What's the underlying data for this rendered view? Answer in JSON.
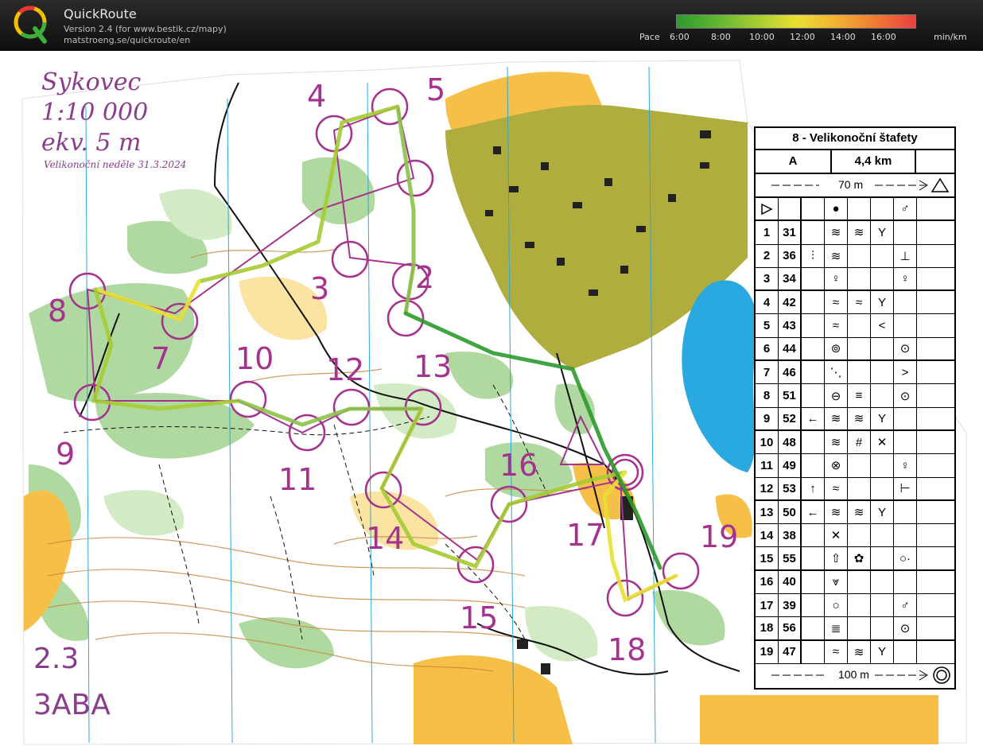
{
  "app": {
    "title": "QuickRoute",
    "version": "Version 2.4  (for www.bestik.cz/mapy)",
    "url": "matstroeng.se/quickroute/en",
    "logo_letter": "Q"
  },
  "pace_legend": {
    "label": "Pace",
    "ticks": [
      "6:00",
      "8:00",
      "10:00",
      "12:00",
      "14:00",
      "16:00"
    ],
    "unit": "min/km",
    "colors": [
      "#2e9a2e",
      "#5fb533",
      "#a6cc33",
      "#e8e033",
      "#f2b233",
      "#f07a33",
      "#e84040"
    ]
  },
  "map": {
    "name": "Sykovec",
    "scale": "1:10 000",
    "equidistance": "ekv. 5 m",
    "event_date": "Velikonoční neděle 31.3.2024",
    "corner_number": "2.3",
    "corner_code": "3ABA",
    "colors": {
      "forest_white": "#ffffff",
      "green": "#9fd18a",
      "light_green": "#cfe8bf",
      "open": "#f7c34a",
      "rough_open": "#fbe2a0",
      "settlement": "#a9a83a",
      "water": "#2aa8e0",
      "course": "#a5328f",
      "contour": "#c9823a"
    },
    "control_labels": [
      "2",
      "3",
      "4",
      "5",
      "7",
      "8",
      "9",
      "10",
      "11",
      "12",
      "13",
      "14",
      "15",
      "16",
      "17",
      "18",
      "19"
    ]
  },
  "description": {
    "title": "8 - Velikonoční štafety",
    "class": "A",
    "length": "4,4 km",
    "start_distance": "70 m",
    "finish_distance": "100 m",
    "rows": [
      {
        "n": "1",
        "code": "31",
        "d": [
          "",
          "≋",
          "≋",
          "Y",
          ""
        ]
      },
      {
        "n": "2",
        "code": "36",
        "d": [
          "⫶",
          "≋",
          "",
          "",
          "⊥"
        ]
      },
      {
        "n": "3",
        "code": "34",
        "d": [
          "",
          "♀",
          "",
          "",
          "♀"
        ]
      },
      {
        "n": "4",
        "code": "42",
        "d": [
          "",
          "≈",
          "≈",
          "Y",
          ""
        ]
      },
      {
        "n": "5",
        "code": "43",
        "d": [
          "",
          "≈",
          "",
          "<",
          ""
        ]
      },
      {
        "n": "6",
        "code": "44",
        "d": [
          "",
          "⊚",
          "",
          "",
          "⊙"
        ]
      },
      {
        "n": "7",
        "code": "46",
        "d": [
          "",
          "⋱",
          "",
          "",
          ">"
        ]
      },
      {
        "n": "8",
        "code": "51",
        "d": [
          "",
          "⊖",
          "≡",
          "",
          "⊙"
        ]
      },
      {
        "n": "9",
        "code": "52",
        "d": [
          "←",
          "≋",
          "≋",
          "Y",
          ""
        ]
      },
      {
        "n": "10",
        "code": "48",
        "d": [
          "",
          "≋",
          "#",
          "✕",
          ""
        ]
      },
      {
        "n": "11",
        "code": "49",
        "d": [
          "",
          "⊗",
          "",
          "",
          "♀"
        ]
      },
      {
        "n": "12",
        "code": "53",
        "d": [
          "↑",
          "≈",
          "",
          "",
          "⊢"
        ]
      },
      {
        "n": "13",
        "code": "50",
        "d": [
          "←",
          "≋",
          "≋",
          "Y",
          ""
        ]
      },
      {
        "n": "14",
        "code": "38",
        "d": [
          "",
          "✕",
          "",
          "",
          ""
        ]
      },
      {
        "n": "15",
        "code": "55",
        "d": [
          "",
          "⇧",
          "✿",
          "",
          "○·"
        ]
      },
      {
        "n": "16",
        "code": "40",
        "d": [
          "",
          "⩔",
          "",
          "",
          ""
        ]
      },
      {
        "n": "17",
        "code": "39",
        "d": [
          "",
          "○",
          "",
          "",
          "♂"
        ]
      },
      {
        "n": "18",
        "code": "56",
        "d": [
          "",
          "≣",
          "",
          "",
          "⊙"
        ]
      },
      {
        "n": "19",
        "code": "47",
        "d": [
          "",
          "≈",
          "≋",
          "Y",
          ""
        ]
      }
    ]
  }
}
